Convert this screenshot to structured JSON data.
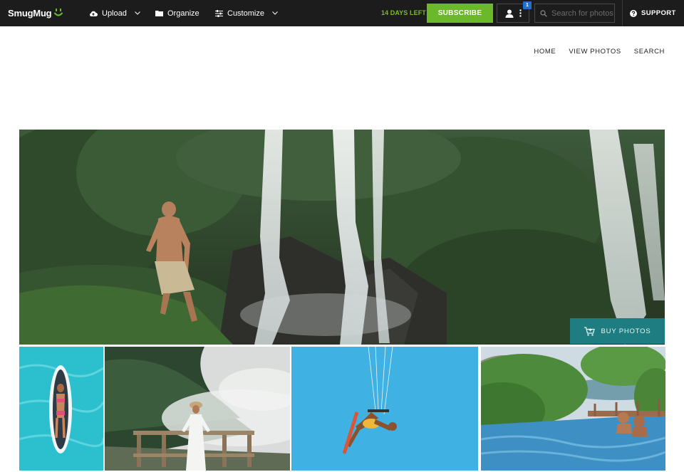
{
  "toolbar": {
    "logo_text": "SmugMug",
    "upload_label": "Upload",
    "organize_label": "Organize",
    "customize_label": "Customize",
    "trial_text": "14 DAYS LEFT",
    "subscribe_label": "SUBSCRIBE",
    "notification_count": "1",
    "search_placeholder": "Search for photos",
    "support_label": "SUPPORT",
    "accent_color": "#6cb82b"
  },
  "site_nav": {
    "items": [
      {
        "label": "HOME"
      },
      {
        "label": "VIEW PHOTOS"
      },
      {
        "label": "SEARCH"
      }
    ]
  },
  "hero": {
    "buy_label": "BUY PHOTOS",
    "buy_color": "#1d7d80"
  },
  "gallery": {
    "thumbnails": [
      {
        "subject": "paddleboard-in-pool"
      },
      {
        "subject": "woman-on-misty-lookout"
      },
      {
        "subject": "kitesurfer-in-sky"
      },
      {
        "subject": "couple-in-infinity-pool"
      }
    ]
  }
}
